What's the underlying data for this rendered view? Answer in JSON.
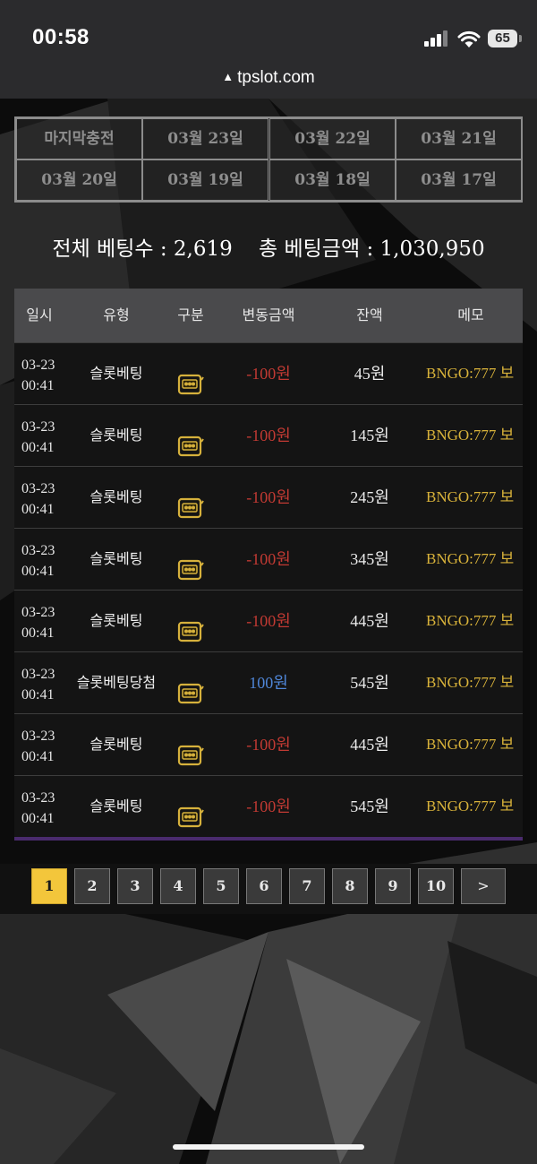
{
  "status_bar": {
    "time": "00:58",
    "battery": "65"
  },
  "browser": {
    "url": "tpslot.com"
  },
  "date_tabs": [
    "마지막충전",
    "03월 23일",
    "03월 22일",
    "03월 21일",
    "03월 20일",
    "03월 19일",
    "03월 18일",
    "03월 17일"
  ],
  "summary": {
    "bet_count_label": "전체 베팅수",
    "bet_count": "2,619",
    "bet_amount_label": "총 베팅금액",
    "bet_amount": "1,030,950"
  },
  "table": {
    "headers": [
      "일시",
      "유형",
      "구분",
      "변동금액",
      "잔액",
      "메모"
    ],
    "rows": [
      {
        "date": "03-23",
        "time": "00:41",
        "type": "슬롯베팅",
        "icon": "slot-machine-icon",
        "amount": "-100원",
        "sign": "neg",
        "balance": "45원",
        "memo": "BNGO:777 보"
      },
      {
        "date": "03-23",
        "time": "00:41",
        "type": "슬롯베팅",
        "icon": "slot-machine-icon",
        "amount": "-100원",
        "sign": "neg",
        "balance": "145원",
        "memo": "BNGO:777 보"
      },
      {
        "date": "03-23",
        "time": "00:41",
        "type": "슬롯베팅",
        "icon": "slot-machine-icon",
        "amount": "-100원",
        "sign": "neg",
        "balance": "245원",
        "memo": "BNGO:777 보"
      },
      {
        "date": "03-23",
        "time": "00:41",
        "type": "슬롯베팅",
        "icon": "slot-machine-icon",
        "amount": "-100원",
        "sign": "neg",
        "balance": "345원",
        "memo": "BNGO:777 보"
      },
      {
        "date": "03-23",
        "time": "00:41",
        "type": "슬롯베팅",
        "icon": "slot-machine-icon",
        "amount": "-100원",
        "sign": "neg",
        "balance": "445원",
        "memo": "BNGO:777 보"
      },
      {
        "date": "03-23",
        "time": "00:41",
        "type": "슬롯베팅당첨",
        "icon": "slot-machine-icon",
        "amount": "100원",
        "sign": "pos",
        "balance": "545원",
        "memo": "BNGO:777 보"
      },
      {
        "date": "03-23",
        "time": "00:41",
        "type": "슬롯베팅",
        "icon": "slot-machine-icon",
        "amount": "-100원",
        "sign": "neg",
        "balance": "445원",
        "memo": "BNGO:777 보"
      },
      {
        "date": "03-23",
        "time": "00:41",
        "type": "슬롯베팅",
        "icon": "slot-machine-icon",
        "amount": "-100원",
        "sign": "neg",
        "balance": "545원",
        "memo": "BNGO:777 보"
      }
    ]
  },
  "pagination": {
    "pages": [
      "1",
      "2",
      "3",
      "4",
      "5",
      "6",
      "7",
      "8",
      "9",
      "10"
    ],
    "current": "1",
    "next_label": ">"
  },
  "colors": {
    "negative": "#c23a33",
    "positive": "#4f86d8",
    "memo": "#d8b23a",
    "active_page": "#f3c63b"
  }
}
